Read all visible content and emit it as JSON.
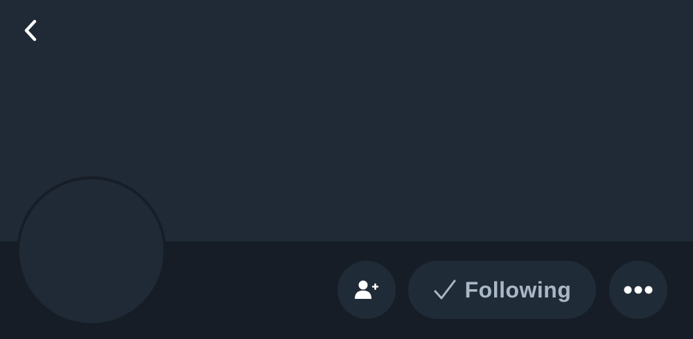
{
  "colors": {
    "banner": "#1f2a36",
    "background": "#161d26",
    "button_bg": "#202b38",
    "button_text": "#aab8c6",
    "icon_white": "#ffffff"
  },
  "header": {
    "back_icon": "chevron-left-icon"
  },
  "actions": {
    "follow_icon": "person-plus-icon",
    "following_icon": "checkmark-icon",
    "following_label": "Following",
    "more_icon": "ellipsis-icon"
  }
}
